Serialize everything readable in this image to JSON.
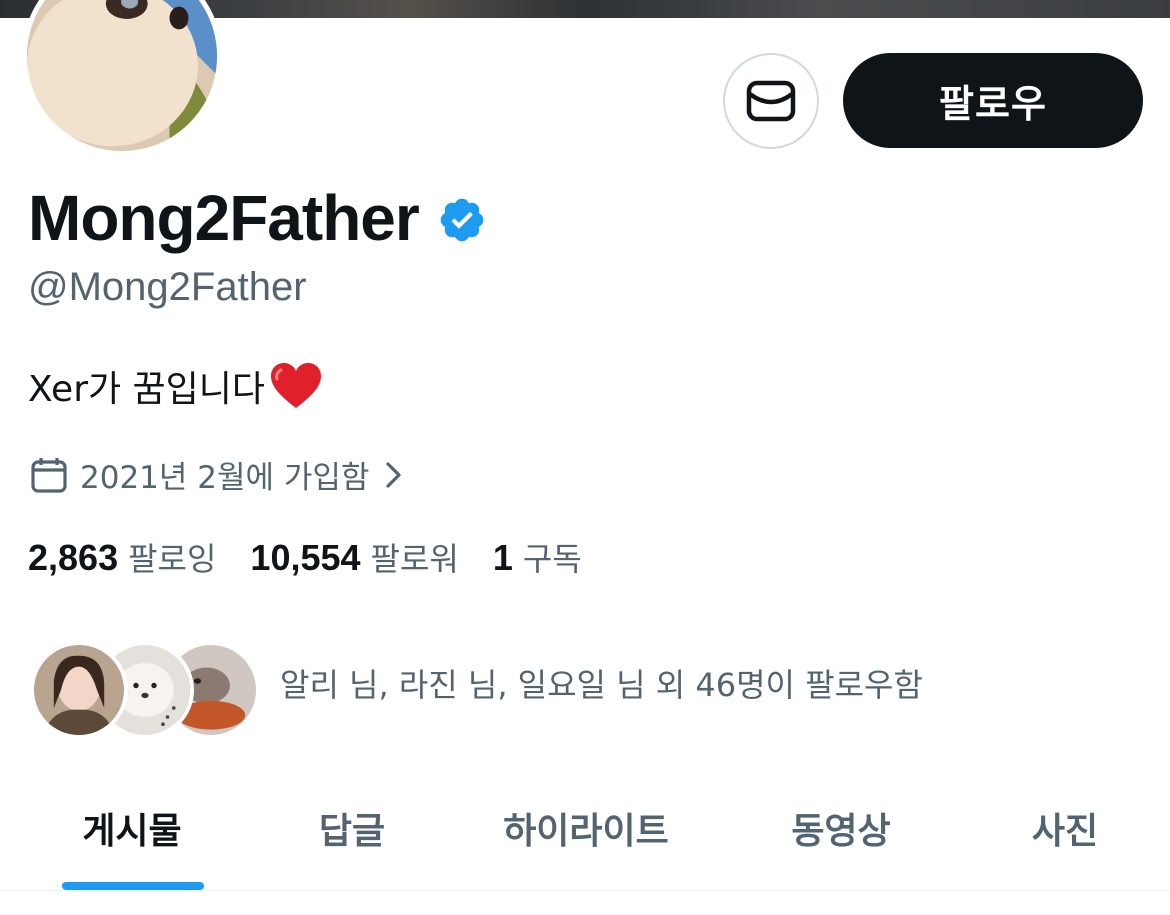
{
  "profile": {
    "display_name": "Mong2Father",
    "handle": "@Mong2Father",
    "bio": "Xer가 꿈입니다",
    "joined": "2021년 2월에 가입함",
    "verified": true
  },
  "actions": {
    "follow_label": "팔로우"
  },
  "stats": {
    "following_count": "2,863",
    "following_label": "팔로잉",
    "followers_count": "10,554",
    "followers_label": "팔로워",
    "subscriptions_count": "1",
    "subscriptions_label": "구독"
  },
  "known_followers": {
    "text": "알리 님, 라진 님, 일요일 님 외 46명이 팔로우함"
  },
  "tabs": [
    {
      "label": "게시물",
      "active": true
    },
    {
      "label": "답글",
      "active": false
    },
    {
      "label": "하이라이트",
      "active": false
    },
    {
      "label": "동영상",
      "active": false
    },
    {
      "label": "사진",
      "active": false
    }
  ],
  "colors": {
    "accent": "#1d9bf0",
    "text_primary": "#0f1419",
    "text_secondary": "#536471",
    "follow_button_bg": "#0f1419"
  },
  "icons": {
    "message": "envelope-icon",
    "verified": "verified-badge-icon",
    "calendar": "calendar-icon",
    "chevron": "chevron-right-icon",
    "heart": "red-heart-emoji"
  }
}
